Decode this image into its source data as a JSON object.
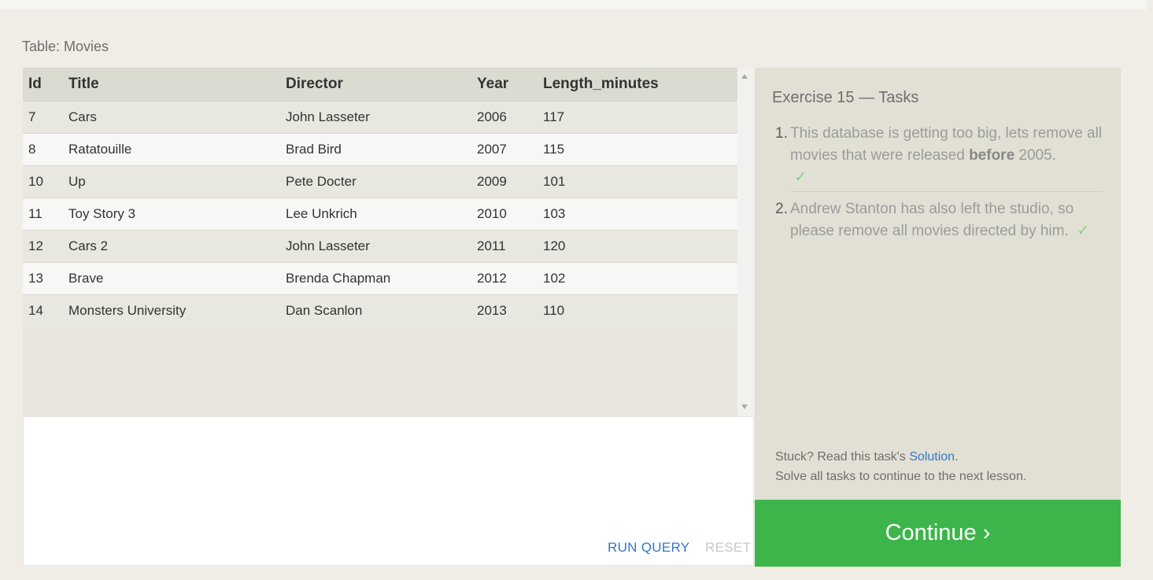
{
  "table_caption": "Table: Movies",
  "table": {
    "columns": [
      "Id",
      "Title",
      "Director",
      "Year",
      "Length_minutes"
    ],
    "rows": [
      [
        "7",
        "Cars",
        "John Lasseter",
        "2006",
        "117"
      ],
      [
        "8",
        "Ratatouille",
        "Brad Bird",
        "2007",
        "115"
      ],
      [
        "10",
        "Up",
        "Pete Docter",
        "2009",
        "101"
      ],
      [
        "11",
        "Toy Story 3",
        "Lee Unkrich",
        "2010",
        "103"
      ],
      [
        "12",
        "Cars 2",
        "John Lasseter",
        "2011",
        "120"
      ],
      [
        "13",
        "Brave",
        "Brenda Chapman",
        "2012",
        "102"
      ],
      [
        "14",
        "Monsters University",
        "Dan Scanlon",
        "2013",
        "110"
      ]
    ]
  },
  "editor": {
    "run_query_label": "RUN QUERY",
    "reset_label": "RESET"
  },
  "tasks": {
    "title": "Exercise 15 — Tasks",
    "items": [
      {
        "number": "1.",
        "text_before": "This database is getting too big, lets remove all movies that were released ",
        "bold": "before",
        "text_after": " 2005.",
        "check": "✓"
      },
      {
        "number": "2.",
        "text": "Andrew Stanton has also left the studio, so please remove all movies directed by him.",
        "check": "✓"
      }
    ],
    "help_prefix": "Stuck? Read this task's ",
    "help_link": "Solution",
    "help_suffix": ".",
    "help_line2": "Solve all tasks to continue to the next lesson."
  },
  "continue_label": "Continue ›",
  "colors": {
    "background": "#efede6",
    "continue_green": "#3db54a",
    "link_blue": "#3477c6",
    "check_green": "#7ed57e"
  },
  "icons": [
    "scroll-up-arrow-icon",
    "scroll-down-arrow-icon",
    "checkmark-icon"
  ]
}
